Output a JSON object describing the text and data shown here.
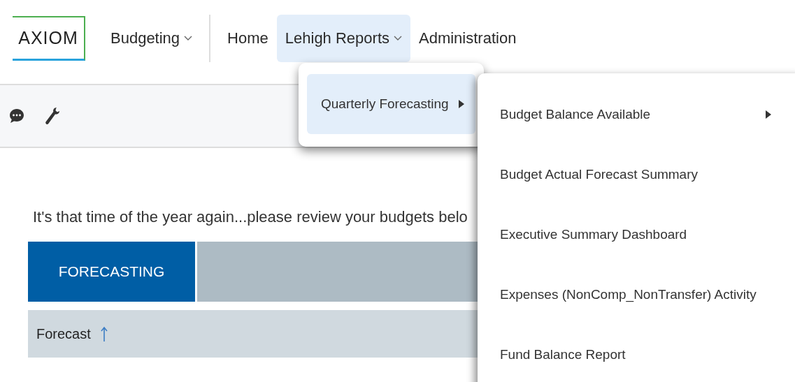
{
  "logo": "AXIOM",
  "module": {
    "label": "Budgeting",
    "dropdown": true
  },
  "nav": [
    {
      "label": "Home",
      "selected": false,
      "dropdown": false
    },
    {
      "label": "Lehigh Reports",
      "selected": true,
      "dropdown": true
    },
    {
      "label": "Administration",
      "selected": false,
      "dropdown": false
    }
  ],
  "toolbar": [
    {
      "kind": "chat"
    },
    {
      "kind": "wrench"
    }
  ],
  "message": "It's that time of the year again...please review your budgets belo",
  "tabs": [
    {
      "label": "FORECASTING",
      "selected": true
    }
  ],
  "table": {
    "columns": [
      {
        "label": "Forecast",
        "sorted_ascending": true
      }
    ]
  },
  "menu": {
    "items": [
      {
        "label": "Quarterly Forecasting",
        "selected": true,
        "submenu": true
      }
    ]
  },
  "submenu": {
    "items": [
      {
        "label": "Budget Balance Available",
        "submenu": true
      },
      {
        "label": "Budget Actual Forecast Summary",
        "submenu": false
      },
      {
        "label": "Executive Summary Dashboard",
        "submenu": false
      },
      {
        "label": "Expenses (NonComp_NonTransfer) Activity",
        "submenu": false
      },
      {
        "label": "Fund Balance Report",
        "submenu": false
      }
    ]
  }
}
